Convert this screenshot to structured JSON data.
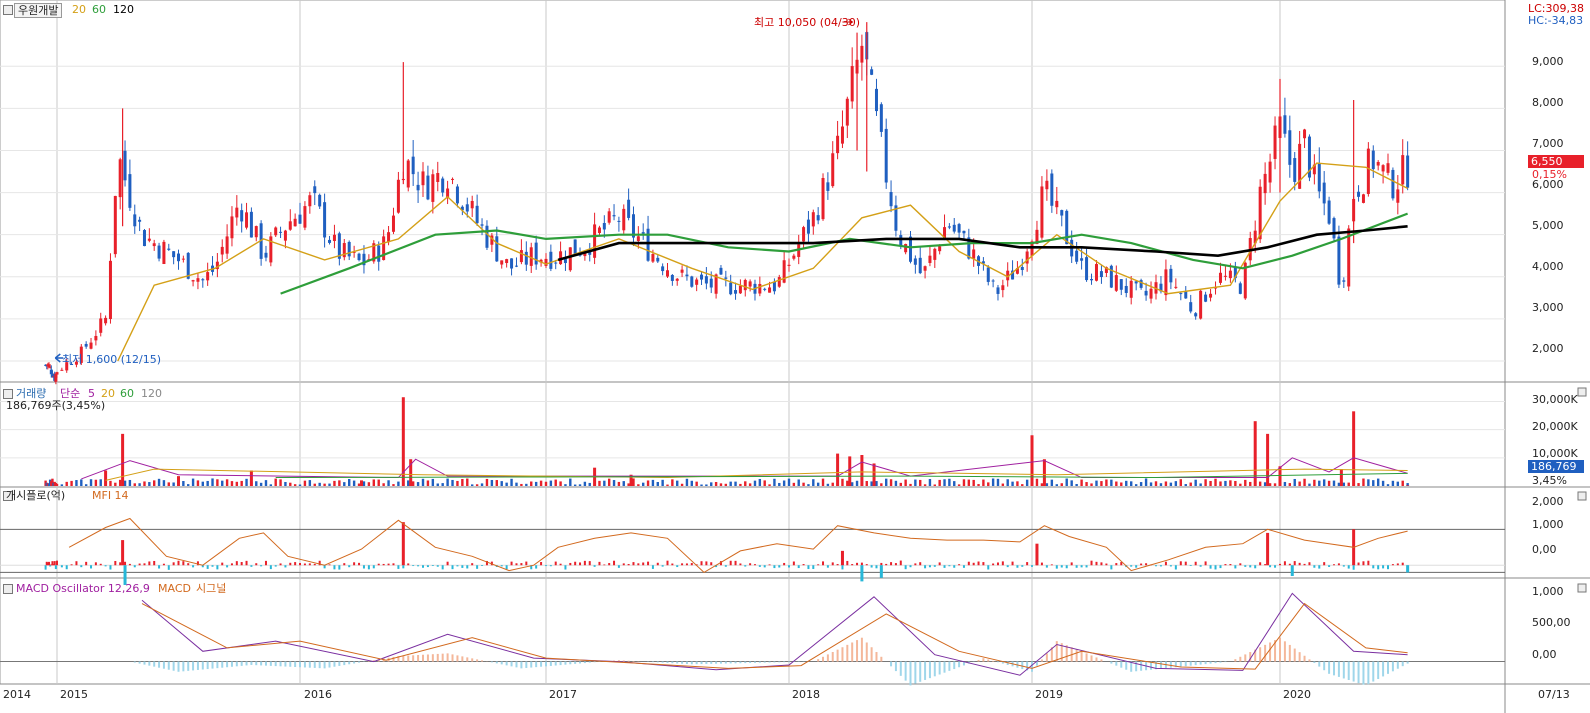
{
  "main": {
    "title": "우원개발",
    "ma_labels": [
      "20",
      "60",
      "120"
    ],
    "ma_colors": {
      "20": "#d4a017",
      "60": "#2e9e3a",
      "120": "#000000"
    },
    "lc": "LC:309,38",
    "hc": "HC:-34,83",
    "high_note": "최고 10,050 (04/30)",
    "low_note": "최저 1,600 (12/15)",
    "price_tag": "6,550",
    "change_tag": "0,15%",
    "y_ticks": [
      "9,000",
      "8,000",
      "7,000",
      "6,000",
      "5,000",
      "4,000",
      "3,000",
      "2,000"
    ]
  },
  "volume": {
    "title": "거래량",
    "ma_prefix": "단순",
    "ma_labels": [
      "5",
      "20",
      "60",
      "120"
    ],
    "value_line": "186,769주(3,45%)",
    "y_ticks": [
      "30,000K",
      "20,000K",
      "10,000K"
    ],
    "tag": "186,769",
    "tag2": "3,45%"
  },
  "mfi": {
    "title": "개시플로(억)",
    "label": "MFI 14",
    "y_ticks": [
      "2,000",
      "1,000",
      "0,00"
    ]
  },
  "macd": {
    "label1": "MACD Oscillator 12,26,9",
    "label2": "MACD",
    "label3": "시그널",
    "y_ticks": [
      "1,000",
      "500,00",
      "0,00"
    ]
  },
  "x_axis": [
    "2014",
    "2015",
    "2016",
    "2017",
    "2018",
    "2019",
    "2020"
  ],
  "date_tag": "07/13",
  "colors": {
    "up": "#e8202a",
    "down": "#1f5fc0",
    "grid": "#c8c8c8"
  },
  "chart_data": [
    {
      "type": "candlestick",
      "x_labels": [
        "2014",
        "2015",
        "2016",
        "2017",
        "2018",
        "2019",
        "2020"
      ],
      "ylim": [
        1500,
        10100
      ],
      "close": [
        [
          2014.85,
          1900
        ],
        [
          2014.96,
          1600
        ],
        [
          2015.1,
          2200
        ],
        [
          2015.2,
          3000
        ],
        [
          2015.25,
          6900
        ],
        [
          2015.35,
          5000
        ],
        [
          2015.5,
          4400
        ],
        [
          2015.6,
          3900
        ],
        [
          2015.65,
          4200
        ],
        [
          2015.75,
          5800
        ],
        [
          2015.85,
          4500
        ],
        [
          2015.95,
          5300
        ],
        [
          2016.05,
          5800
        ],
        [
          2016.15,
          4600
        ],
        [
          2016.25,
          4300
        ],
        [
          2016.35,
          4800
        ],
        [
          2016.42,
          6800
        ],
        [
          2016.5,
          6200
        ],
        [
          2016.6,
          6500
        ],
        [
          2016.72,
          5300
        ],
        [
          2016.85,
          4200
        ],
        [
          2016.95,
          4500
        ],
        [
          2017.05,
          4500
        ],
        [
          2017.15,
          4700
        ],
        [
          2017.3,
          5400
        ],
        [
          2017.45,
          4500
        ],
        [
          2017.55,
          4000
        ],
        [
          2017.65,
          3800
        ],
        [
          2017.8,
          3800
        ],
        [
          2017.95,
          3800
        ],
        [
          2018.1,
          5400
        ],
        [
          2018.2,
          7000
        ],
        [
          2018.3,
          9500
        ],
        [
          2018.38,
          7000
        ],
        [
          2018.45,
          5000
        ],
        [
          2018.55,
          4000
        ],
        [
          2018.65,
          5300
        ],
        [
          2018.75,
          4600
        ],
        [
          2018.85,
          3600
        ],
        [
          2018.95,
          4300
        ],
        [
          2019.05,
          6000
        ],
        [
          2019.12,
          5200
        ],
        [
          2019.2,
          4200
        ],
        [
          2019.3,
          4000
        ],
        [
          2019.45,
          3500
        ],
        [
          2019.55,
          4000
        ],
        [
          2019.65,
          3200
        ],
        [
          2019.75,
          4000
        ],
        [
          2019.85,
          3800
        ],
        [
          2019.92,
          6000
        ],
        [
          2020.0,
          7500
        ],
        [
          2020.05,
          6500
        ],
        [
          2020.1,
          7200
        ],
        [
          2020.15,
          6000
        ],
        [
          2020.2,
          5500
        ],
        [
          2020.25,
          3700
        ],
        [
          2020.3,
          6000
        ],
        [
          2020.38,
          6800
        ],
        [
          2020.45,
          6200
        ],
        [
          2020.52,
          6550
        ]
      ],
      "high": 10050,
      "low": 1600,
      "last": 6550,
      "series": [
        {
          "name": "20",
          "values": [
            [
              2015.25,
              2000
            ],
            [
              2015.4,
              3800
            ],
            [
              2015.65,
              4200
            ],
            [
              2015.85,
              4900
            ],
            [
              2016.1,
              4400
            ],
            [
              2016.4,
              4900
            ],
            [
              2016.6,
              5900
            ],
            [
              2016.8,
              4800
            ],
            [
              2017.0,
              4300
            ],
            [
              2017.3,
              4900
            ],
            [
              2017.6,
              4200
            ],
            [
              2017.85,
              3700
            ],
            [
              2018.1,
              4200
            ],
            [
              2018.3,
              5400
            ],
            [
              2018.5,
              5700
            ],
            [
              2018.7,
              4600
            ],
            [
              2018.9,
              4000
            ],
            [
              2019.1,
              5000
            ],
            [
              2019.3,
              4200
            ],
            [
              2019.55,
              3600
            ],
            [
              2019.8,
              3800
            ],
            [
              2020.0,
              5800
            ],
            [
              2020.15,
              6700
            ],
            [
              2020.35,
              6600
            ],
            [
              2020.52,
              6100
            ]
          ]
        },
        {
          "name": "60",
          "values": [
            [
              2015.92,
              3600
            ],
            [
              2016.2,
              4200
            ],
            [
              2016.55,
              5000
            ],
            [
              2016.8,
              5100
            ],
            [
              2017.0,
              4900
            ],
            [
              2017.3,
              5000
            ],
            [
              2017.5,
              5000
            ],
            [
              2017.75,
              4700
            ],
            [
              2018.0,
              4600
            ],
            [
              2018.25,
              4900
            ],
            [
              2018.5,
              4700
            ],
            [
              2018.75,
              4800
            ],
            [
              2019.0,
              4800
            ],
            [
              2019.2,
              5000
            ],
            [
              2019.4,
              4800
            ],
            [
              2019.65,
              4400
            ],
            [
              2019.85,
              4200
            ],
            [
              2020.05,
              4500
            ],
            [
              2020.25,
              4900
            ],
            [
              2020.52,
              5500
            ]
          ]
        },
        {
          "name": "120",
          "values": [
            [
              2017.05,
              4400
            ],
            [
              2017.3,
              4800
            ],
            [
              2017.55,
              4800
            ],
            [
              2017.8,
              4800
            ],
            [
              2018.1,
              4800
            ],
            [
              2018.4,
              4900
            ],
            [
              2018.7,
              4900
            ],
            [
              2018.95,
              4700
            ],
            [
              2019.2,
              4700
            ],
            [
              2019.5,
              4600
            ],
            [
              2019.75,
              4500
            ],
            [
              2019.95,
              4700
            ],
            [
              2020.15,
              5000
            ],
            [
              2020.35,
              5100
            ],
            [
              2020.52,
              5200
            ]
          ]
        }
      ]
    },
    {
      "type": "bar",
      "title": "거래량",
      "ylim": [
        0,
        33000
      ],
      "x": [
        2015.2,
        2015.27,
        2015.5,
        2015.8,
        2016.25,
        2016.42,
        2016.45,
        2017.2,
        2017.35,
        2018.2,
        2018.25,
        2018.3,
        2018.35,
        2019.0,
        2019.05,
        2019.9,
        2019.95,
        2020.0,
        2020.25,
        2020.3,
        2020.52
      ],
      "values": [
        5500,
        18500,
        3500,
        5500,
        2000,
        31500,
        9500,
        6500,
        4000,
        11500,
        10500,
        11000,
        8000,
        18000,
        9500,
        23000,
        18500,
        7000,
        6000,
        26500,
        187
      ]
    },
    {
      "type": "line",
      "ylim": [
        -600,
        3800
      ],
      "series": [
        {
          "name": "MFI 14",
          "values": [
            [
              2015.05,
              1000
            ],
            [
              2015.2,
              2100
            ],
            [
              2015.3,
              2600
            ],
            [
              2015.45,
              500
            ],
            [
              2015.6,
              0
            ],
            [
              2015.75,
              1500
            ],
            [
              2015.85,
              1800
            ],
            [
              2015.95,
              500
            ],
            [
              2016.1,
              0
            ],
            [
              2016.25,
              900
            ],
            [
              2016.4,
              2500
            ],
            [
              2016.55,
              1000
            ],
            [
              2016.7,
              500
            ],
            [
              2016.85,
              -300
            ],
            [
              2016.95,
              0
            ],
            [
              2017.05,
              1000
            ],
            [
              2017.2,
              1500
            ],
            [
              2017.35,
              1800
            ],
            [
              2017.5,
              1500
            ],
            [
              2017.65,
              -400
            ],
            [
              2017.8,
              800
            ],
            [
              2017.95,
              1200
            ],
            [
              2018.1,
              900
            ],
            [
              2018.2,
              2200
            ],
            [
              2018.35,
              1800
            ],
            [
              2018.5,
              1500
            ],
            [
              2018.65,
              1400
            ],
            [
              2018.8,
              1400
            ],
            [
              2018.95,
              1300
            ],
            [
              2019.05,
              2200
            ],
            [
              2019.15,
              1600
            ],
            [
              2019.3,
              1000
            ],
            [
              2019.4,
              -300
            ],
            [
              2019.55,
              300
            ],
            [
              2019.7,
              1000
            ],
            [
              2019.85,
              1200
            ],
            [
              2019.95,
              2000
            ],
            [
              2020.1,
              1400
            ],
            [
              2020.2,
              1200
            ],
            [
              2020.3,
              1000
            ],
            [
              2020.4,
              1500
            ],
            [
              2020.52,
              1900
            ]
          ]
        }
      ]
    },
    {
      "type": "line",
      "ylim": [
        -300,
        1050
      ],
      "series": [
        {
          "name": "MACD Oscillator 12,26,9",
          "values": [
            [
              2015.35,
              900
            ],
            [
              2015.6,
              150
            ],
            [
              2015.9,
              300
            ],
            [
              2016.3,
              0
            ],
            [
              2016.6,
              400
            ],
            [
              2016.95,
              50
            ],
            [
              2017.3,
              0
            ],
            [
              2017.7,
              -120
            ],
            [
              2018.0,
              -50
            ],
            [
              2018.35,
              950
            ],
            [
              2018.6,
              100
            ],
            [
              2018.95,
              -200
            ],
            [
              2019.1,
              250
            ],
            [
              2019.5,
              -100
            ],
            [
              2019.85,
              -130
            ],
            [
              2020.05,
              1000
            ],
            [
              2020.3,
              150
            ],
            [
              2020.52,
              100
            ]
          ]
        },
        {
          "name": "MACD",
          "values": [
            [
              2015.35,
              850
            ],
            [
              2015.7,
              200
            ],
            [
              2016.0,
              300
            ],
            [
              2016.35,
              20
            ],
            [
              2016.7,
              350
            ],
            [
              2017.0,
              50
            ],
            [
              2017.35,
              -20
            ],
            [
              2017.75,
              -100
            ],
            [
              2018.05,
              -60
            ],
            [
              2018.4,
              700
            ],
            [
              2018.7,
              150
            ],
            [
              2019.0,
              -100
            ],
            [
              2019.2,
              150
            ],
            [
              2019.6,
              -80
            ],
            [
              2019.9,
              -110
            ],
            [
              2020.1,
              850
            ],
            [
              2020.35,
              200
            ],
            [
              2020.52,
              130
            ]
          ]
        },
        {
          "name": "시그널",
          "values": [
            [
              2015.3,
              0
            ],
            [
              2015.5,
              -150
            ],
            [
              2015.8,
              -50
            ],
            [
              2016.1,
              -100
            ],
            [
              2016.4,
              80
            ],
            [
              2016.6,
              120
            ],
            [
              2016.9,
              -100
            ],
            [
              2017.3,
              20
            ],
            [
              2017.6,
              -40
            ],
            [
              2018.1,
              0
            ],
            [
              2018.3,
              350
            ],
            [
              2018.5,
              -350
            ],
            [
              2018.8,
              50
            ],
            [
              2019.0,
              -150
            ],
            [
              2019.1,
              300
            ],
            [
              2019.4,
              -150
            ],
            [
              2019.8,
              0
            ],
            [
              2020.0,
              350
            ],
            [
              2020.2,
              -180
            ],
            [
              2020.35,
              -350
            ],
            [
              2020.52,
              -30
            ]
          ]
        }
      ]
    }
  ]
}
